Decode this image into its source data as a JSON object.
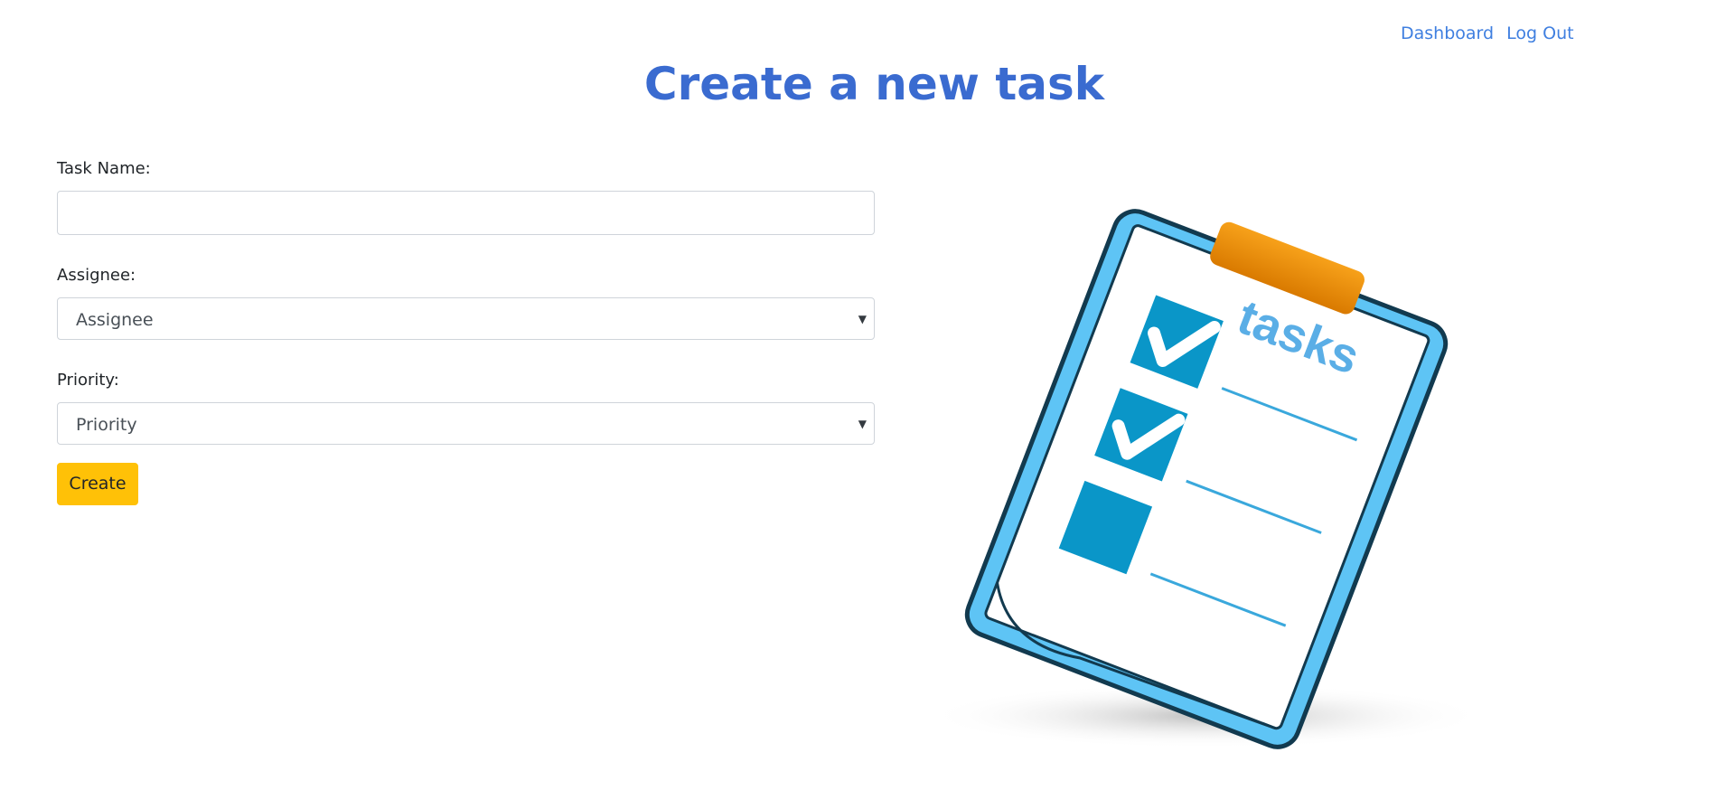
{
  "nav": {
    "dashboard": "Dashboard",
    "logout": "Log Out"
  },
  "page_title": "Create a new task",
  "form": {
    "task_name_label": "Task Name:",
    "task_name_value": "",
    "assignee_label": "Assignee:",
    "assignee_value": "Assignee",
    "priority_label": "Priority:",
    "priority_value": "Priority",
    "create_label": "Create"
  },
  "illustration": {
    "text": "tasks",
    "icon": "clipboard-checklist-icon",
    "colors": {
      "primary": "#0a96c8",
      "frame": "#5ec4f5",
      "clip": "#f29100",
      "outline": "#123a4f"
    }
  },
  "colors": {
    "link": "#3f7fe0",
    "title": "#3a6bd0",
    "button": "#ffc107"
  }
}
